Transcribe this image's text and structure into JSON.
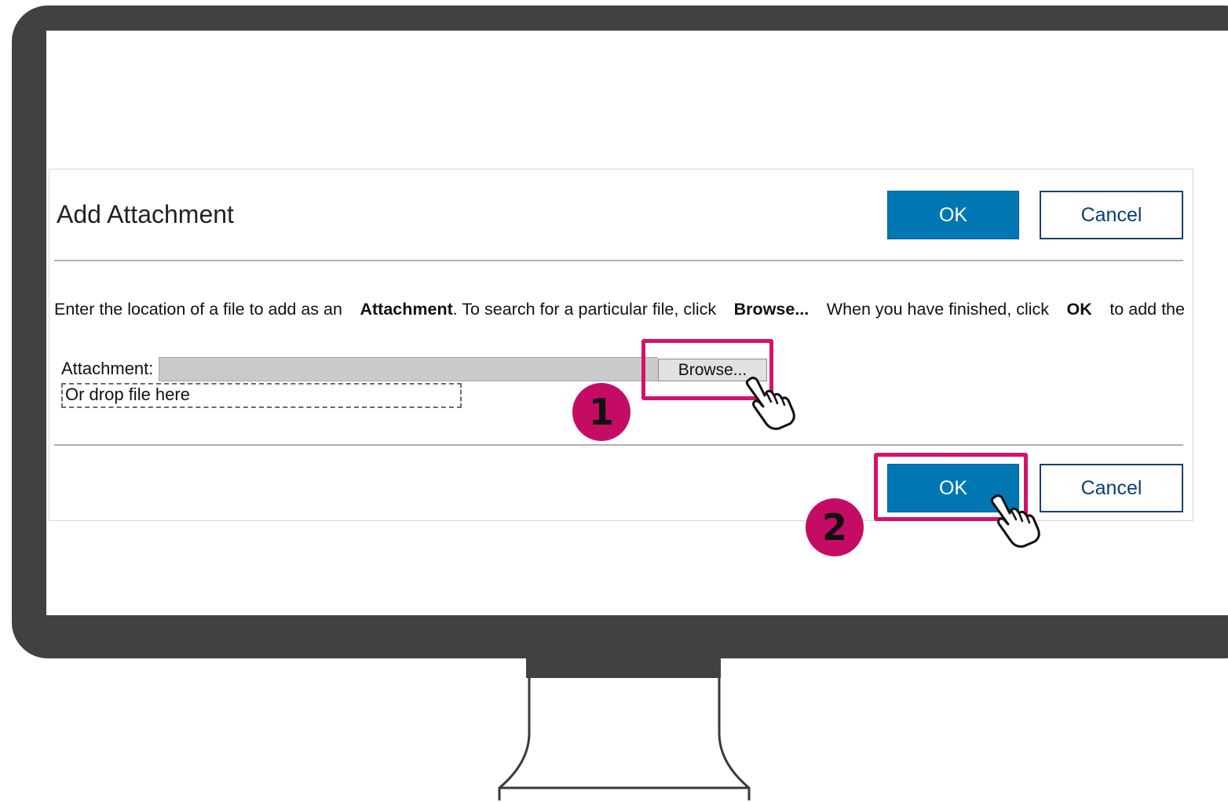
{
  "dialog": {
    "title": "Add Attachment",
    "ok_label": "OK",
    "cancel_label": "Cancel",
    "instructions": {
      "part1": "Enter the location of a file to add as an",
      "bold1": "Attachment",
      "part2": ". To search for a particular file, click",
      "bold2": "Browse...",
      "part3": "When you have finished, click",
      "bold3": "OK",
      "part4": "to add the"
    },
    "attachment_label": "Attachment:",
    "attachment_value": "",
    "browse_label": "Browse...",
    "drop_zone_text": "Or drop file here"
  },
  "callouts": {
    "step1": "1",
    "step2": "2"
  },
  "colors": {
    "primary": "#0077b3",
    "highlight": "#d6106d",
    "step_circle": "#c40c64",
    "bezel": "#414141"
  }
}
